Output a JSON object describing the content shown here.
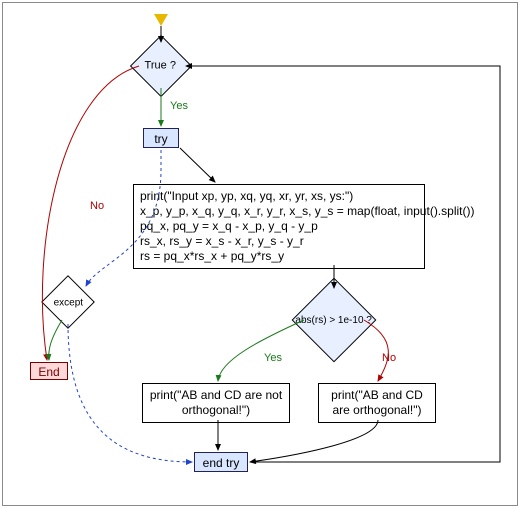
{
  "cond_true": "True ?",
  "cond_true_yes": "Yes",
  "cond_true_no": "No",
  "try_label": "try",
  "except_label": "except",
  "code_block": "print(\"Input xp, yp, xq, yq, xr, yr, xs, ys:\")\nx_p, y_p, x_q, y_q, x_r, y_r, x_s, y_s = map(float, input().split())\npq_x, pq_y = x_q - x_p, y_q - y_p\nrs_x, rs_y = x_s - x_r, y_s - y_r\nrs = pq_x*rs_x + pq_y*rs_y",
  "cond_abs": "abs(rs) > 1e-10 ?",
  "cond_abs_yes": "Yes",
  "cond_abs_no": "No",
  "print_not": "print(\"AB and CD are not\northogonal!\")",
  "print_yes": "print(\"AB and CD\nare orthogonal!\")",
  "end_try": "end try",
  "end_label": "End",
  "chart_data": {
    "type": "flowchart",
    "nodes": [
      {
        "id": "start",
        "kind": "start"
      },
      {
        "id": "cond_true",
        "kind": "decision",
        "label": "True ?"
      },
      {
        "id": "try",
        "kind": "label",
        "label": "try"
      },
      {
        "id": "code",
        "kind": "process",
        "label": "print(\"Input xp, yp, xq, yq, xr, yr, xs, ys:\")\\nx_p, y_p, x_q, y_q, x_r, y_r, x_s, y_s = map(float, input().split())\\npq_x, pq_y = x_q - x_p, y_q - y_p\\nrs_x, rs_y = x_s - x_r, y_s - y_r\\nrs = pq_x*rs_x + pq_y*rs_y"
      },
      {
        "id": "cond_abs",
        "kind": "decision",
        "label": "abs(rs) > 1e-10 ?"
      },
      {
        "id": "print_not",
        "kind": "process",
        "label": "print(\"AB and CD are not orthogonal!\")"
      },
      {
        "id": "print_yes",
        "kind": "process",
        "label": "print(\"AB and CD are orthogonal!\")"
      },
      {
        "id": "end_try",
        "kind": "label",
        "label": "end try"
      },
      {
        "id": "except",
        "kind": "decision",
        "label": "except"
      },
      {
        "id": "end",
        "kind": "terminal",
        "label": "End"
      }
    ],
    "edges": [
      {
        "from": "start",
        "to": "cond_true"
      },
      {
        "from": "cond_true",
        "to": "try",
        "label": "Yes",
        "color": "green"
      },
      {
        "from": "cond_true",
        "to": "end",
        "label": "No",
        "color": "red"
      },
      {
        "from": "try",
        "to": "code"
      },
      {
        "from": "code",
        "to": "cond_abs"
      },
      {
        "from": "cond_abs",
        "to": "print_not",
        "label": "Yes",
        "color": "green"
      },
      {
        "from": "cond_abs",
        "to": "print_yes",
        "label": "No",
        "color": "red"
      },
      {
        "from": "print_not",
        "to": "end_try"
      },
      {
        "from": "print_yes",
        "to": "end_try"
      },
      {
        "from": "end_try",
        "to": "cond_true",
        "kind": "loop_back"
      },
      {
        "from": "try",
        "to": "except",
        "kind": "dotted",
        "color": "blue"
      },
      {
        "from": "except",
        "to": "end",
        "color": "green"
      },
      {
        "from": "except",
        "to": "end_try",
        "kind": "dotted",
        "color": "blue"
      }
    ]
  }
}
